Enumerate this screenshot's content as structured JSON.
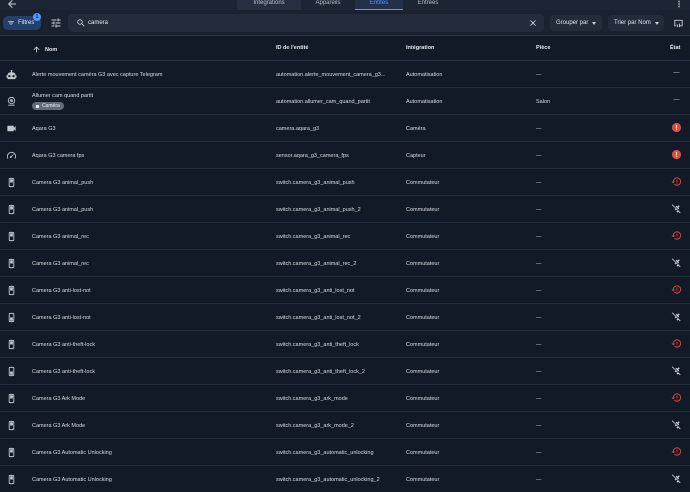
{
  "tabs": [
    "Intégrations",
    "Appareils",
    "Entités",
    "Entrées"
  ],
  "toolbar": {
    "filters_label": "Filtres",
    "filters_count": "1",
    "search_value": "camera",
    "group_label": "Grouper par",
    "sort_label": "Trier par Nom"
  },
  "columns": {
    "name": "Nom",
    "entity_id": "ID de l'entité",
    "integration": "Intégration",
    "area": "Pièce",
    "state": "État"
  },
  "colors": {
    "accent": "#4d9cff",
    "error": "#e04a3f",
    "text": "#d9dde3"
  },
  "rows": [
    {
      "icon": "robot-icon",
      "name": "Alerte mouvement caméra G3 avec capture Telegram",
      "entity_id": "automation.alerte_mouvement_camera_g3...",
      "integration": "Automatisation",
      "area": "—",
      "state": "dash"
    },
    {
      "icon": "cctv-icon",
      "name": "Allumer cam quand partit",
      "chip": "Caméra",
      "entity_id": "automation.allumer_cam_quand_partit",
      "integration": "Automatisation",
      "area": "Salon",
      "state": "dash"
    },
    {
      "icon": "video-icon",
      "name": "Aqara G3",
      "entity_id": "camera.aqara_g3",
      "integration": "Caméra",
      "area": "—",
      "state": "error"
    },
    {
      "icon": "gauge-icon",
      "name": "Aqara G3 camera fps",
      "entity_id": "sensor.aqara_g3_camera_fps",
      "integration": "Capteur",
      "area": "—",
      "state": "error"
    },
    {
      "icon": "toggle-switch-icon",
      "name": "Camera G3 animal_push",
      "entity_id": "switch.camera_g3_animal_push",
      "integration": "Commutateur",
      "area": "—",
      "state": "restore"
    },
    {
      "icon": "toggle-switch-icon",
      "name": "Camera G3 animal_push",
      "entity_id": "switch.camera_g3_animal_push_2",
      "integration": "Commutateur",
      "area": "—",
      "state": "unavailable"
    },
    {
      "icon": "toggle-switch-icon",
      "name": "Camera G3 animal_rec",
      "entity_id": "switch.camera_g3_animal_rec",
      "integration": "Commutateur",
      "area": "—",
      "state": "restore"
    },
    {
      "icon": "toggle-switch-icon",
      "name": "Camera G3 animal_rec",
      "entity_id": "switch.camera_g3_animal_rec_2",
      "integration": "Commutateur",
      "area": "—",
      "state": "unavailable"
    },
    {
      "icon": "toggle-switch-icon",
      "name": "Camera G3 anti-lost-not",
      "entity_id": "switch.camera_g3_anti_lost_not",
      "integration": "Commutateur",
      "area": "—",
      "state": "restore"
    },
    {
      "icon": "toggle-switch-off-icon",
      "name": "Camera G3 anti-lost-not",
      "entity_id": "switch.camera_g3_anti_lost_not_2",
      "integration": "Commutateur",
      "area": "—",
      "state": "unavailable"
    },
    {
      "icon": "toggle-switch-icon",
      "name": "Camera G3 anti-theft-lock",
      "entity_id": "switch.camera_g3_anti_theft_lock",
      "integration": "Commutateur",
      "area": "—",
      "state": "restore"
    },
    {
      "icon": "toggle-switch-off-icon",
      "name": "Camera G3 anti-theft-lock",
      "entity_id": "switch.camera_g3_anti_theft_lock_2",
      "integration": "Commutateur",
      "area": "—",
      "state": "unavailable"
    },
    {
      "icon": "toggle-switch-icon",
      "name": "Camera G3 Ark Mode",
      "entity_id": "switch.camera_g3_ark_mode",
      "integration": "Commutateur",
      "area": "—",
      "state": "restore"
    },
    {
      "icon": "toggle-switch-icon",
      "name": "Camera G3 Ark Mode",
      "entity_id": "switch.camera_g3_ark_mode_2",
      "integration": "Commutateur",
      "area": "—",
      "state": "unavailable"
    },
    {
      "icon": "toggle-switch-icon",
      "name": "Camera G3 Automatic Unlocking",
      "entity_id": "switch.camera_g3_automatic_unlocking",
      "integration": "Commutateur",
      "area": "—",
      "state": "restore"
    },
    {
      "icon": "toggle-switch-icon",
      "name": "Camera G3 Automatic Unlocking",
      "entity_id": "switch.camera_g3_automatic_unlocking_2",
      "integration": "Commutateur",
      "area": "—",
      "state": "unavailable"
    }
  ]
}
